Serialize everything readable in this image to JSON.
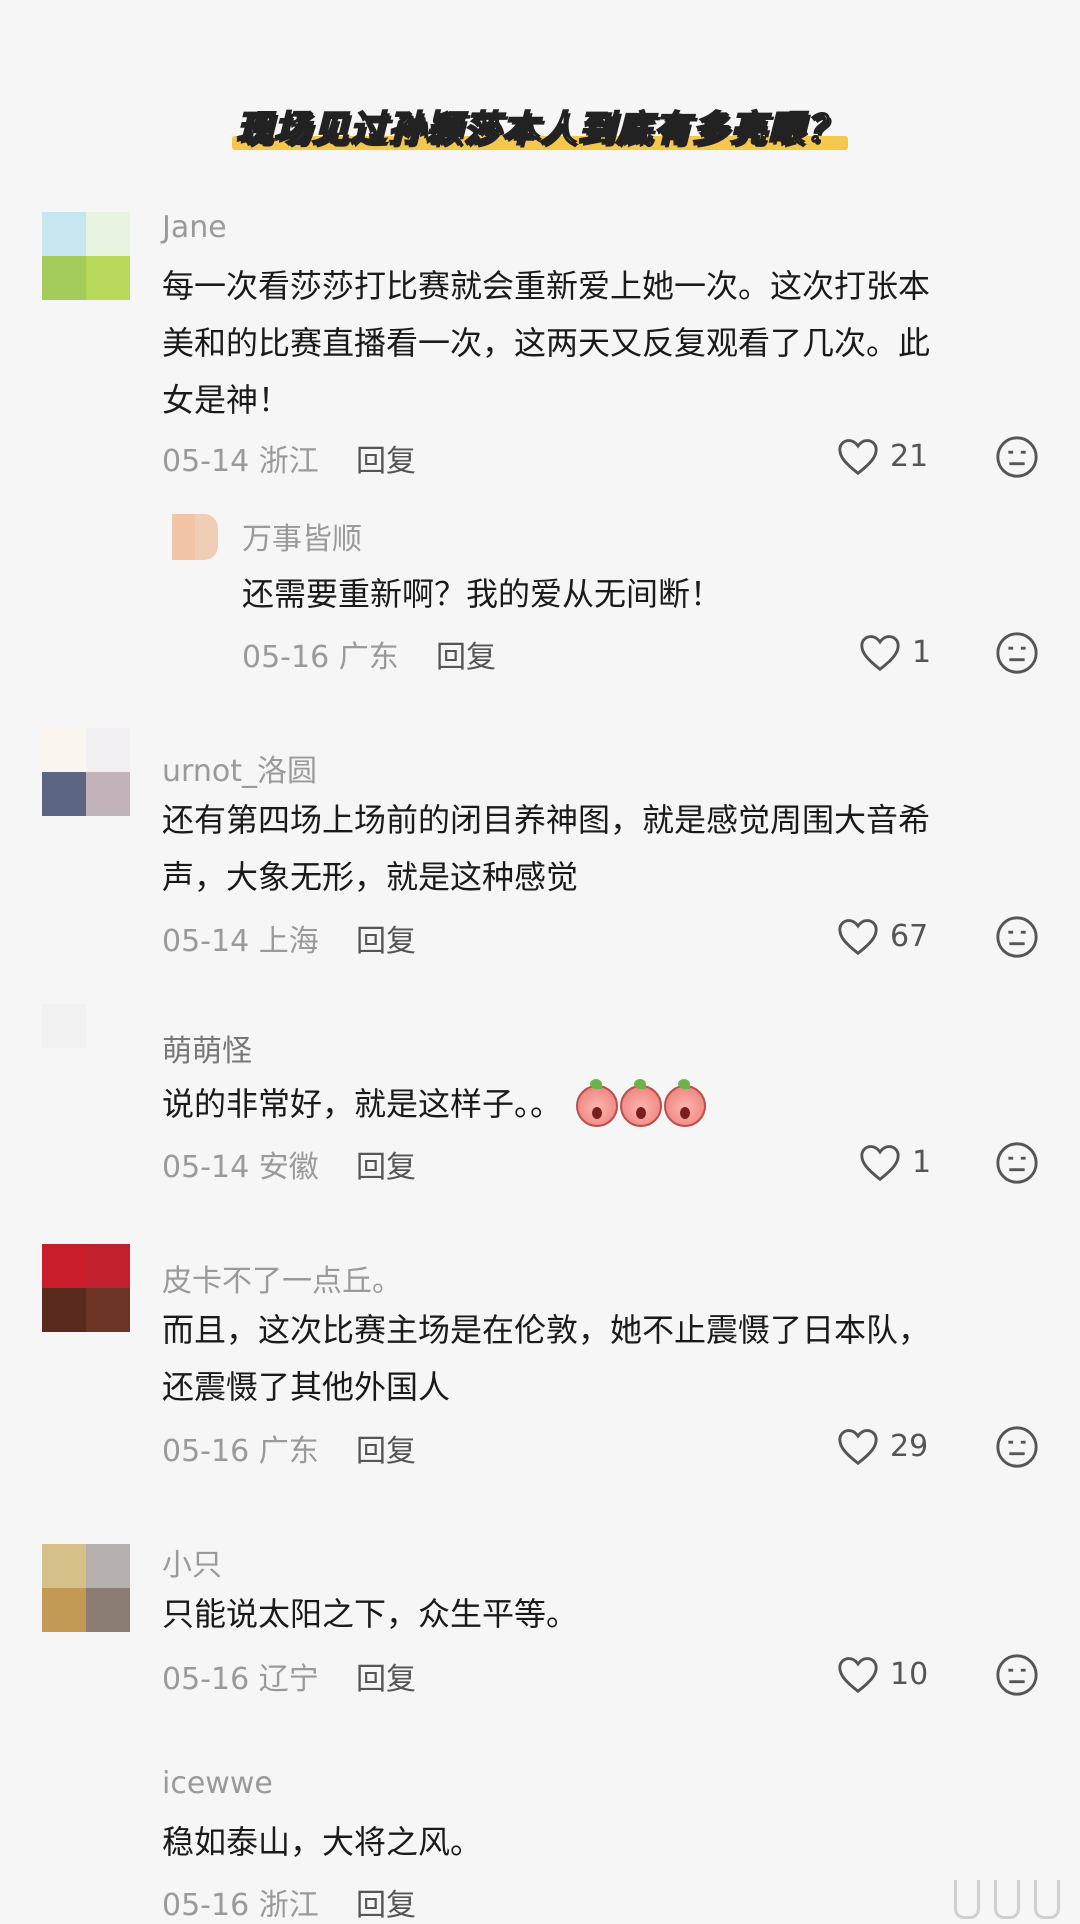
{
  "title": "现场见过孙颖莎本人到底有多亮眼？",
  "comments": [
    {
      "username": "Jane",
      "lines": [
        "每一次看莎莎打比赛就会重新爱上她一次。这次打张本",
        "美和的比赛直播看一次，这两天又反复观看了几次。此",
        "女是神！"
      ],
      "date_loc": "05-14 浙江",
      "reply_label": "回复",
      "likes": "21",
      "avatar_colors": [
        "#c8e6f0",
        "#e8f4e0",
        "#a3cc5a",
        "#b8d85a"
      ]
    },
    {
      "username": "万事皆顺",
      "lines": [
        "还需要重新啊？我的爱从无间断！"
      ],
      "date_loc": "05-16 广东",
      "reply_label": "回复",
      "likes": "1",
      "avatar_colors": [
        "#f2c4a8",
        "#f0cdb5",
        "#f2c4a8",
        "#f0cdb5"
      ]
    },
    {
      "username": "urnot_洛圆",
      "lines": [
        "还有第四场上场前的闭目养神图，就是感觉周围大音希",
        "声，大象无形，就是这种感觉"
      ],
      "date_loc": "05-14 上海",
      "reply_label": "回复",
      "likes": "67",
      "avatar_colors": [
        "#faf5ee",
        "#f3f0f4",
        "#5c6682",
        "#c2b2ba"
      ]
    },
    {
      "username": "萌萌怪",
      "lines": [
        "说的非常好，就是这样子。。"
      ],
      "date_loc": "05-14 安徽",
      "reply_label": "回复",
      "likes": "1",
      "avatar_colors": [
        "#f2f2f2",
        "#f6f6f6",
        "#f6f6f6",
        "#f6f6f6"
      ]
    },
    {
      "username": "皮卡不了一点丘。",
      "lines": [
        "而且，这次比赛主场是在伦敦，她不止震慑了日本队，",
        "还震慑了其他外国人"
      ],
      "date_loc": "05-16 广东",
      "reply_label": "回复",
      "likes": "29",
      "avatar_colors": [
        "#c91d2c",
        "#c3202f",
        "#5a2a1e",
        "#6c3424"
      ]
    },
    {
      "username": "小只",
      "lines": [
        "只能说太阳之下，众生平等。"
      ],
      "date_loc": "05-16 辽宁",
      "reply_label": "回复",
      "likes": "10",
      "avatar_colors": [
        "#d6c08a",
        "#b5b0ad",
        "#c39a55",
        "#8b7d74"
      ]
    },
    {
      "username": "icewwe",
      "lines": [
        "稳如泰山，大将之风。"
      ],
      "date_loc": "05-16 浙江",
      "reply_label": "回复",
      "likes": "",
      "avatar_colors": [
        "#f6f6f6",
        "#f6f6f6",
        "#f6f6f6",
        "#f6f6f6"
      ]
    }
  ]
}
